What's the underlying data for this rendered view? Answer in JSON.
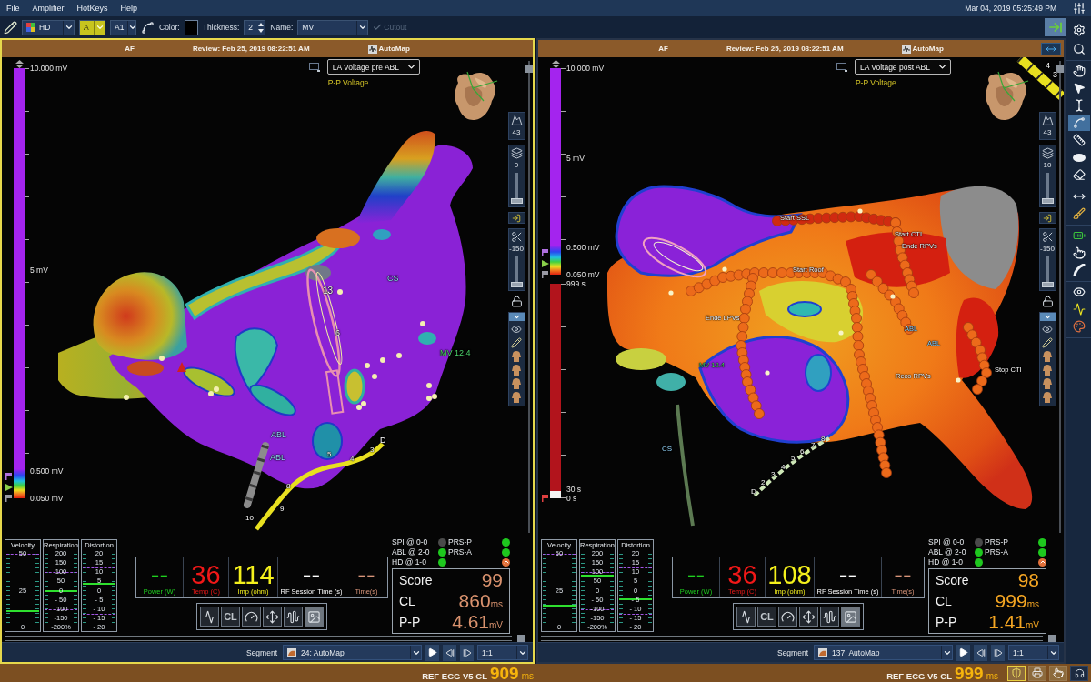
{
  "menu_bar": {
    "items": [
      {
        "label": "File"
      },
      {
        "label": "Amplifier"
      },
      {
        "label": "HotKeys"
      },
      {
        "label": "Help"
      }
    ],
    "clock": "Mar 04, 2019 05:25:49 PM"
  },
  "toolbar": {
    "map_type": "HD",
    "channel": "A",
    "sub_channel": "A1",
    "color_label": "Color:",
    "thickness_label": "Thickness:",
    "thickness": "2",
    "name_label": "Name:",
    "name": "MV",
    "cutout": {
      "label": "Cutout",
      "disabled": true
    }
  },
  "tool_groups": [
    {
      "tools": [
        {
          "kind": "settings",
          "selected": false
        },
        {
          "kind": "zoom",
          "selected": false
        }
      ]
    },
    {
      "tools": [
        {
          "kind": "pan",
          "selected": false
        },
        {
          "kind": "pointer",
          "selected": false
        },
        {
          "kind": "text",
          "selected": false
        },
        {
          "kind": "curve",
          "selected": true
        },
        {
          "kind": "ruler",
          "selected": false
        },
        {
          "kind": "ellipse",
          "selected": false
        },
        {
          "kind": "eraser",
          "selected": false
        }
      ]
    },
    {
      "tools": [
        {
          "kind": "measure",
          "selected": false
        },
        {
          "kind": "brush",
          "selected": false
        }
      ]
    },
    {
      "tools": [
        {
          "kind": "battery",
          "selected": false
        },
        {
          "kind": "touch",
          "selected": false
        },
        {
          "kind": "catheter",
          "selected": false
        }
      ]
    },
    {
      "tools": [
        {
          "kind": "eye",
          "selected": false
        },
        {
          "kind": "signal",
          "selected": false
        },
        {
          "kind": "palette",
          "selected": false
        }
      ]
    }
  ],
  "panels": [
    {
      "active": true,
      "expand_button": false,
      "header": {
        "rhythm": "AF",
        "review": "Review: Feb 25, 2019 08:22:51 AM",
        "map": "AutoMap"
      },
      "scales": [
        {
          "kind": "voltage",
          "labels": [
            "10.000 mV",
            "5 mV",
            "0.500 mV",
            "0.050 mV"
          ]
        }
      ],
      "layer": "LA Voltage pre ABL",
      "map_mode": "P-P Voltage",
      "side_controls": [
        {
          "kind": "peak",
          "text": "43"
        },
        {
          "kind": "opacity",
          "text": "0",
          "level": 0
        },
        {
          "kind": "clip",
          "text": "-150",
          "level": 0
        }
      ],
      "map_labels": [
        {
          "text": "13",
          "kind": "electrode"
        },
        {
          "text": "6",
          "kind": "electrode"
        },
        {
          "text": "CS",
          "kind": "catheter"
        },
        {
          "text": "MV 12.4",
          "kind": "landmark"
        },
        {
          "text": "ABL",
          "kind": "catheter"
        },
        {
          "text": "ABL",
          "kind": "catheter"
        },
        {
          "text": "D",
          "kind": "electrode"
        },
        {
          "text": "3",
          "kind": "electrode"
        },
        {
          "text": "4",
          "kind": "electrode"
        },
        {
          "text": "5",
          "kind": "electrode"
        },
        {
          "text": "8",
          "kind": "electrode"
        },
        {
          "text": "9",
          "kind": "electrode"
        },
        {
          "text": "10",
          "kind": "electrode"
        }
      ],
      "gauges": [
        {
          "title": "Velocity",
          "ticks": [
            "50",
            "25",
            "0"
          ],
          "level": 0.22
        },
        {
          "title": "Respiration",
          "ticks": [
            "200",
            "150",
            "100",
            "50",
            "0",
            "- 50",
            "-100",
            "-150",
            "-200%"
          ],
          "level": 0.49
        },
        {
          "title": "Distortion",
          "ticks": [
            "20",
            "15",
            "10",
            "5",
            "0",
            "- 5",
            "- 10",
            "- 15",
            "- 20"
          ],
          "level": 0.59
        }
      ],
      "ablation": [
        {
          "value": "--",
          "label": "Power (W)",
          "color": "#1fd01f"
        },
        {
          "value": "36",
          "label": "Temp (C)",
          "color": "#f01818"
        },
        {
          "value": "114",
          "label": "Imp (ohm)",
          "color": "#f4f01c"
        },
        {
          "value": "--",
          "label": "RF Session Time (s)",
          "color": "#ffffff"
        },
        {
          "value": "--",
          "label": "Time(s)",
          "color": "#d9957a"
        }
      ],
      "quick_tools": [
        {
          "kind": "ecg",
          "selected": false
        },
        {
          "kind": "text",
          "label": "CL",
          "selected": false
        },
        {
          "kind": "speedometer",
          "selected": false
        },
        {
          "kind": "move",
          "selected": false
        },
        {
          "kind": "waveform",
          "selected": false
        },
        {
          "kind": "image",
          "selected": true
        }
      ],
      "connections": [
        {
          "kind": "led",
          "label": "SPI @ 0-0",
          "color": "#4a4a4a"
        },
        {
          "kind": "led",
          "label": "PRS-P",
          "color": "#1ec81e"
        },
        {
          "kind": "led",
          "label": "ABL @ 2-0",
          "color": "#1ec81e"
        },
        {
          "kind": "led",
          "label": "PRS-A",
          "color": "#1ec81e"
        },
        {
          "kind": "led",
          "label": "HD @ 1-0",
          "color": "#1ec81e"
        },
        {
          "kind": "alert",
          "color": "#e0703a"
        }
      ],
      "score": {
        "color": "#d9926e",
        "rows": [
          {
            "label": "Score",
            "value": "99"
          },
          {
            "label": "CL",
            "value": "860",
            "unit": "ms"
          },
          {
            "label": "P-P",
            "value": "4.61",
            "unit": "mV"
          }
        ]
      },
      "segment": {
        "label": "Segment",
        "value": "24: AutoMap",
        "speed": "1:1"
      }
    },
    {
      "active": false,
      "expand_button": true,
      "header": {
        "rhythm": "AF",
        "review": "Review: Feb 25, 2019 08:22:51 AM",
        "map": "AutoMap"
      },
      "scales": [
        {
          "kind": "voltage",
          "labels": [
            "10.000 mV",
            "5 mV",
            "0.500 mV",
            "0.050 mV"
          ]
        },
        {
          "kind": "time",
          "labels": [
            "999 s",
            "30 s",
            "0 s"
          ]
        }
      ],
      "layer": "LA Voltage post ABL",
      "map_mode": "P-P Voltage",
      "side_controls": [
        {
          "kind": "peak",
          "text": "43"
        },
        {
          "kind": "opacity",
          "text": "10",
          "level": 0
        },
        {
          "kind": "clip",
          "text": "-150",
          "level": 0
        }
      ],
      "map_labels": [
        {
          "text": "Start SSL",
          "kind": "tag"
        },
        {
          "text": "Start CTI",
          "kind": "tag"
        },
        {
          "text": "Ende RPVs",
          "kind": "tag"
        },
        {
          "text": "Start Roof",
          "kind": "tag"
        },
        {
          "text": "Ende LPVs",
          "kind": "tag"
        },
        {
          "text": "ABL",
          "kind": "catheter"
        },
        {
          "text": "ABL",
          "kind": "catheter"
        },
        {
          "text": "MV 12.4",
          "kind": "landmark"
        },
        {
          "text": "Reco RPVs",
          "kind": "tag"
        },
        {
          "text": "Stop CTI",
          "kind": "tag"
        },
        {
          "text": "CS",
          "kind": "catheter"
        },
        {
          "text": "D",
          "kind": "electrode"
        },
        {
          "text": "2",
          "kind": "electrode"
        },
        {
          "text": "3",
          "kind": "electrode"
        },
        {
          "text": "4",
          "kind": "electrode"
        },
        {
          "text": "5",
          "kind": "electrode"
        },
        {
          "text": "6",
          "kind": "electrode"
        },
        {
          "text": "7",
          "kind": "electrode"
        },
        {
          "text": "8",
          "kind": "electrode"
        },
        {
          "text": "4",
          "kind": "electrode"
        },
        {
          "text": "3",
          "kind": "electrode"
        }
      ],
      "gauges": [
        {
          "title": "Velocity",
          "ticks": [
            "50",
            "25",
            "0"
          ],
          "level": 0.3
        },
        {
          "title": "Respiration",
          "ticks": [
            "200",
            "150",
            "100",
            "50",
            "0",
            "- 50",
            "-100",
            "-150",
            "-200%"
          ],
          "level": 0.7
        },
        {
          "title": "Distortion",
          "ticks": [
            "20",
            "15",
            "10",
            "5",
            "0",
            "- 5",
            "- 10",
            "- 15",
            "- 20"
          ],
          "level": 0.38
        }
      ],
      "ablation": [
        {
          "value": "--",
          "label": "Power (W)",
          "color": "#1fd01f"
        },
        {
          "value": "36",
          "label": "Temp (C)",
          "color": "#f01818"
        },
        {
          "value": "108",
          "label": "Imp (ohm)",
          "color": "#f4f01c"
        },
        {
          "value": "--",
          "label": "RF Session Time (s)",
          "color": "#ffffff"
        },
        {
          "value": "--",
          "label": "Time(s)",
          "color": "#d9957a"
        }
      ],
      "quick_tools": [
        {
          "kind": "ecg",
          "selected": false
        },
        {
          "kind": "text",
          "label": "CL",
          "selected": false
        },
        {
          "kind": "speedometer",
          "selected": false
        },
        {
          "kind": "move",
          "selected": false
        },
        {
          "kind": "waveform",
          "selected": false
        },
        {
          "kind": "image",
          "selected": true
        }
      ],
      "connections": [
        {
          "kind": "led",
          "label": "SPI @ 0-0",
          "color": "#4a4a4a"
        },
        {
          "kind": "led",
          "label": "PRS-P",
          "color": "#1ec81e"
        },
        {
          "kind": "led",
          "label": "ABL @ 2-0",
          "color": "#1ec81e"
        },
        {
          "kind": "led",
          "label": "PRS-A",
          "color": "#1ec81e"
        },
        {
          "kind": "led",
          "label": "HD @ 1-0",
          "color": "#1ec81e"
        },
        {
          "kind": "alert",
          "color": "#e0703a"
        }
      ],
      "score": {
        "color": "#f5a623",
        "rows": [
          {
            "label": "Score",
            "value": "98"
          },
          {
            "label": "CL",
            "value": "999",
            "unit": "ms"
          },
          {
            "label": "P-P",
            "value": "1.41",
            "unit": "mV"
          }
        ]
      },
      "segment": {
        "label": "Segment",
        "value": "137: AutoMap",
        "speed": "1:1"
      }
    }
  ],
  "status_bar": [
    {
      "label": "REF ECG V5 CL",
      "value": "909",
      "unit": "ms"
    },
    {
      "label": "REF ECG V5 CL",
      "value": "999",
      "unit": "ms"
    }
  ]
}
